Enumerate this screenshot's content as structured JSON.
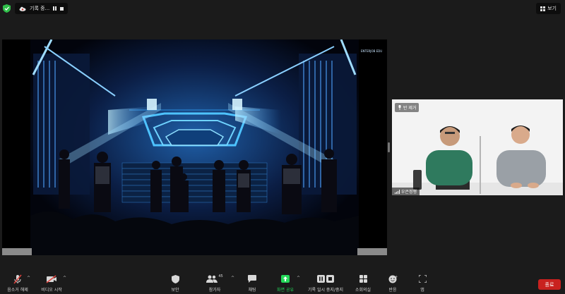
{
  "top_bar": {
    "recording_label": "기록 중...",
    "view_label": "보기"
  },
  "shared_screen": {
    "watermark": "ENTERJOB EDU"
  },
  "participant": {
    "unmute_chip": "반 제거",
    "name": "우은정행"
  },
  "toolbar": {
    "mute": "음소거 해제",
    "video": "비디오 시작",
    "security": "보안",
    "participants": "참가자",
    "participants_count": "45",
    "chat": "채팅",
    "share": "화면 공유",
    "record": "기록 일시 중지/중지",
    "breakout": "소회의실",
    "reactions": "반응",
    "apps": "앱",
    "end": "종료"
  },
  "colors": {
    "share_green": "#23d959",
    "end_red": "#c9211f",
    "muted_red": "#e0443e",
    "shield_green": "#2fbf4a"
  }
}
